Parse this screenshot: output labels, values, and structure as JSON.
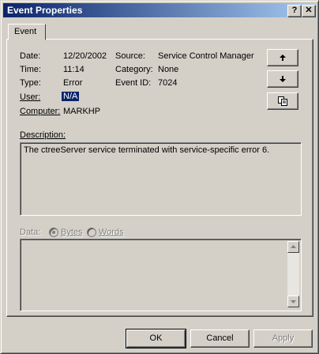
{
  "window": {
    "title": "Event Properties",
    "help_glyph": "?",
    "close_glyph": "✕"
  },
  "tabs": [
    {
      "label": "Event"
    }
  ],
  "fields": {
    "date_label": "Date:",
    "date_value": "12/20/2002",
    "time_label": "Time:",
    "time_value": "11:14",
    "type_label": "Type:",
    "type_value": "Error",
    "user_label": "User:",
    "user_value": "N/A",
    "computer_label": "Computer:",
    "computer_value": "MARKHP",
    "source_label": "Source:",
    "source_value": "Service Control Manager",
    "category_label": "Category:",
    "category_value": "None",
    "eventid_label": "Event ID:",
    "eventid_value": "7024"
  },
  "nav_buttons": {
    "up_icon": "arrow-up-icon",
    "down_icon": "arrow-down-icon",
    "copy_icon": "copy-icon"
  },
  "description": {
    "label": "Description:",
    "text": "The ctreeServer service terminated with service-specific error 6."
  },
  "data_section": {
    "label": "Data:",
    "bytes_label": "Bytes",
    "words_label": "Words",
    "selected": "Bytes"
  },
  "buttons": {
    "ok": "OK",
    "cancel": "Cancel",
    "apply": "Apply"
  }
}
